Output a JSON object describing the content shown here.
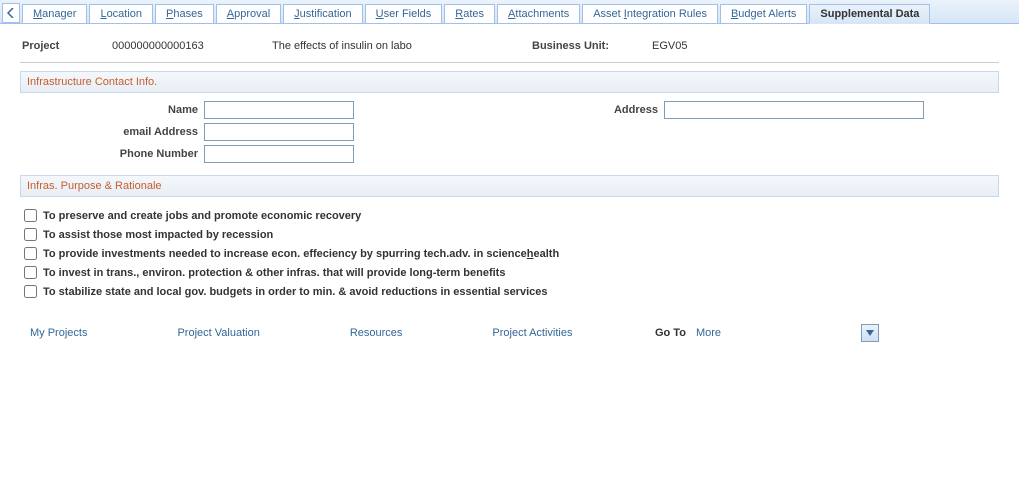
{
  "tabs": [
    {
      "label": "Manager",
      "ul": "M"
    },
    {
      "label": "Location",
      "ul": "L"
    },
    {
      "label": "Phases",
      "ul": "P"
    },
    {
      "label": "Approval",
      "ul": "A"
    },
    {
      "label": "Justification",
      "ul": "J"
    },
    {
      "label": "User Fields",
      "ul": "U"
    },
    {
      "label": "Rates",
      "ul": "R"
    },
    {
      "label": "Attachments",
      "ul": "A"
    },
    {
      "label": "Asset Integration Rules",
      "ul": "I"
    },
    {
      "label": "Budget Alerts",
      "ul": "B"
    },
    {
      "label": "Supplemental Data",
      "ul": ""
    }
  ],
  "active_tab": 10,
  "project_row": {
    "project_label": "Project",
    "project_id": "000000000000163",
    "project_name": "The effects of insulin on labo",
    "bu_label": "Business Unit:",
    "bu_value": "EGV05"
  },
  "section_contact": {
    "title": "Infrastructure Contact Info.",
    "name_label": "Name",
    "email_label": "email Address",
    "phone_label": "Phone Number",
    "address_label": "Address",
    "name_value": "",
    "email_value": "",
    "phone_value": "",
    "address_value": ""
  },
  "section_purpose": {
    "title": "Infras. Purpose & Rationale",
    "items": [
      "To preserve and create jobs and promote economic recovery",
      "To assist those most impacted by recession",
      "To provide investments needed to increase econ. effeciency by spurring tech.adv. in science|health",
      "To invest in trans., environ. protection & other infras. that will provide long-term benefits",
      "To stabilize state and local gov. budgets in order to min. & avoid reductions in essential services"
    ]
  },
  "footer": {
    "links": [
      "My Projects",
      "Project Valuation",
      "Resources",
      "Project Activities"
    ],
    "goto_label": "Go To",
    "goto_value": "More"
  }
}
